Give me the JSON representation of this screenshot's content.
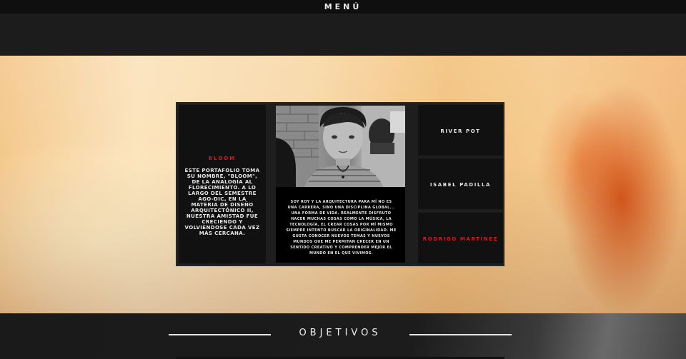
{
  "topbar": {
    "menu_label": "MENÚ"
  },
  "about": {
    "title": "BLOOM",
    "description": "ESTE PORTAFOLIO TOMA SU NOMBRE, \"BLOOM\", DE LA ANALOGÍA AL FLORECIMIENTO. A LO LARGO DEL SEMESTRE AGO-DIC, EN LA MATERIA DE DISEÑO ARQUITECTÓNICO II, NUESTRA AMISTAD FUE CRECIENDO Y VOLVIENDOSE CADA VEZ MÁS CERCANA."
  },
  "profile": {
    "bio": "SOY ROY Y LA ARQUITECTURA PARA MÍ NO ES UNA CARRERA, SINO UNA DISCIPLINA GLOBAL... UNA FORMA DE VIDA. REALMENTE DISFRUTO HACER MUCHAS COSAS COMO LA MÚSICA, LA TECNOLOGÍA, EL CREAR COSAS POR MÍ MISMO SIEMPRE INTENTO BUSCAR LA ORIGINALIDAD. ME GUSTA CONOCER NUEVOS TEMAS Y NUEVOS MUNDOS QUE ME PERMITAN CRECER EN UN SENTIDO CREATIVO Y COMPRENDER MEJOR EL MUNDO EN EL QUE VIVIMOS."
  },
  "members": [
    {
      "name": "RIVER POT",
      "active": false
    },
    {
      "name": "ISABEL PADILLA",
      "active": false
    },
    {
      "name": "RODRIGO MARTÍNEZ",
      "active": true
    }
  ],
  "section": {
    "title": "OBJETIVOS"
  },
  "colors": {
    "accent": "#d8181c",
    "panel": "#111111",
    "background": "#1c1c1c"
  }
}
